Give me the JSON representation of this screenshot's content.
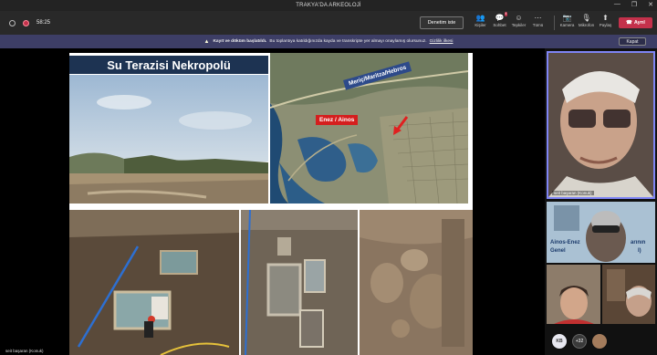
{
  "window": {
    "title": "TRAKYA'DA ARKEOLOJİ",
    "controls": [
      "—",
      "❐",
      "✕"
    ]
  },
  "toolbar": {
    "timer": "58:25",
    "raise_hand": "Denetim iste",
    "items": [
      {
        "icon": "people-icon",
        "glyph": "👥",
        "label": "Kişiler"
      },
      {
        "icon": "chat-icon",
        "glyph": "💬",
        "label": "Sohbet",
        "badge": "4"
      },
      {
        "icon": "reactions-icon",
        "glyph": "☺",
        "label": "Tepkiler"
      },
      {
        "icon": "more-icon",
        "glyph": "⋯",
        "label": "Tümü"
      }
    ],
    "items2": [
      {
        "icon": "camera-off-icon",
        "glyph": "📷",
        "label": "Kamera"
      },
      {
        "icon": "mic-off-icon",
        "glyph": "🎙",
        "label": "Mikrofon"
      },
      {
        "icon": "share-icon",
        "glyph": "⬆",
        "label": "Paylaş"
      }
    ],
    "leave_label": "Ayrıl"
  },
  "banner": {
    "bold": "Kayıt ve döküm başlatıldı.",
    "text": "Bu toplantıya katıldığınızda kayda ve transkripte yer almayı onaylamış olursunuz.",
    "link": "Gizlilik ilkesi",
    "close": "Kapat"
  },
  "slide": {
    "title": "Su Terazisi Nekropolü",
    "map_label_river": "Meriç/Maritza/Hebros",
    "map_label_site": "Enez / Ainos"
  },
  "presenter": {
    "name": "seit başaran (Konuk)"
  },
  "participants": {
    "main_name": "seit başaran (Konuk)",
    "slide_text_line1": "Ainos-Enez",
    "slide_text_line1b": "arının",
    "slide_text_line2": "Genel",
    "slide_text_line2b": "l)",
    "avatar_initials": "KB",
    "more_count": "+32"
  },
  "colors": {
    "accent": "#7f85f5",
    "leave": "#c4314b",
    "banner": "#3d3e66"
  }
}
